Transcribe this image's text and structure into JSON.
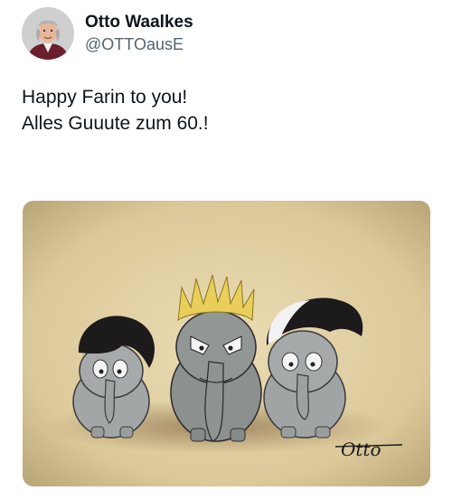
{
  "author": {
    "display_name": "Otto Waalkes",
    "handle": "@OTTOausE",
    "avatar_icon": "user-avatar"
  },
  "tweet": {
    "lines": [
      "Happy Farin to you!",
      "Alles Guuute zum 60.!"
    ]
  },
  "media": {
    "description_icon": "elephant-cartoon-image",
    "signature_text": "Otto",
    "colors": {
      "paper": "#e3d3a8",
      "elephant": "#9ea2a3",
      "hair_blond": "#e9cf5a",
      "hair_black": "#1d1a1b"
    }
  }
}
